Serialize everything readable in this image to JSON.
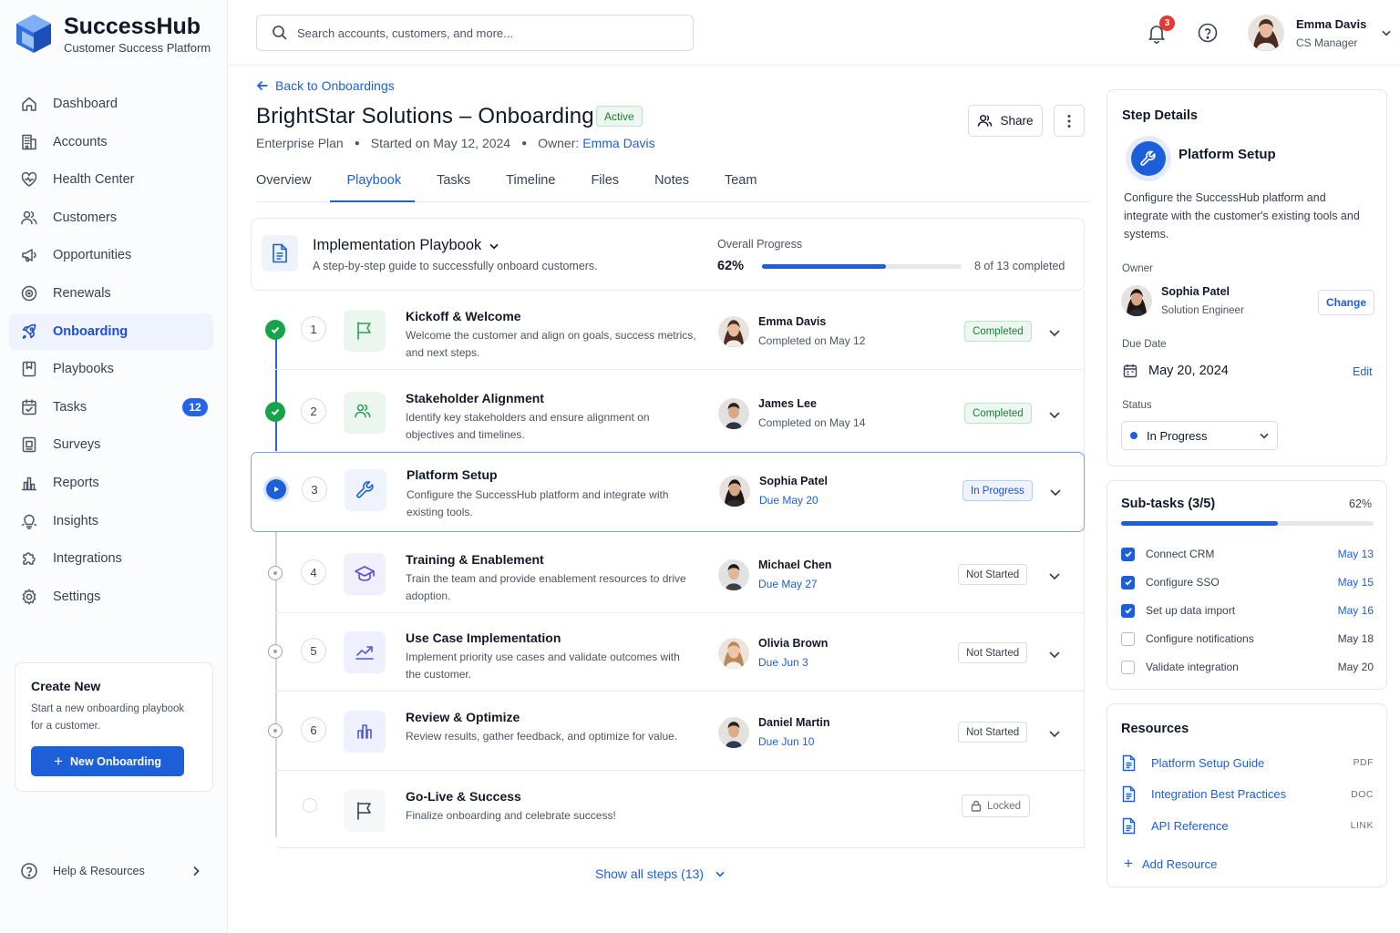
{
  "brand": {
    "name": "SuccessHub",
    "subtitle": "Customer Success Platform"
  },
  "sidebar": {
    "items": [
      {
        "label": "Dashboard",
        "icon": "home-icon"
      },
      {
        "label": "Accounts",
        "icon": "building-icon"
      },
      {
        "label": "Health Center",
        "icon": "heart-icon"
      },
      {
        "label": "Customers",
        "icon": "users-icon"
      },
      {
        "label": "Opportunities",
        "icon": "megaphone-icon"
      },
      {
        "label": "Renewals",
        "icon": "target-icon"
      },
      {
        "label": "Onboarding",
        "icon": "rocket-icon",
        "active": true
      },
      {
        "label": "Playbooks",
        "icon": "bookmark-icon"
      },
      {
        "label": "Tasks",
        "icon": "calendar-check-icon",
        "badge": "12"
      },
      {
        "label": "Surveys",
        "icon": "survey-icon"
      },
      {
        "label": "Reports",
        "icon": "bar-chart-icon"
      },
      {
        "label": "Insights",
        "icon": "lightbulb-icon"
      },
      {
        "label": "Integrations",
        "icon": "puzzle-icon"
      },
      {
        "label": "Settings",
        "icon": "gear-icon"
      }
    ],
    "create_card": {
      "title": "Create New",
      "description": "Start a new onboarding playbook for a customer.",
      "button_label": "New Onboarding"
    },
    "help_label": "Help & Resources"
  },
  "topbar": {
    "search_placeholder": "Search accounts, customers, and more...",
    "notification_count": "3",
    "user": {
      "name": "Emma Davis",
      "role": "CS Manager"
    }
  },
  "header": {
    "back_label": "Back to Onboardings",
    "title": "BrightStar Solutions – Onboarding",
    "status": "Active",
    "plan": "Enterprise Plan",
    "started": "Started on May 12, 2024",
    "owner_prefix": "Owner:",
    "owner_name": "Emma Davis",
    "share_label": "Share"
  },
  "tabs": [
    {
      "label": "Overview"
    },
    {
      "label": "Playbook",
      "active": true
    },
    {
      "label": "Tasks"
    },
    {
      "label": "Timeline"
    },
    {
      "label": "Files"
    },
    {
      "label": "Notes"
    },
    {
      "label": "Team"
    }
  ],
  "playbook": {
    "title": "Implementation Playbook",
    "description": "A step-by-step guide to successfully onboard customers.",
    "progress_label": "Overall Progress",
    "progress_pct": "62%",
    "progress_value": 0.62,
    "completed_text": "8 of 13 completed",
    "show_all_label": "Show all steps (13)",
    "steps": [
      {
        "num": "1",
        "title": "Kickoff & Welcome",
        "desc": "Welcome the customer and align on goals, success metrics, and next steps.",
        "person": "Emma Davis",
        "sub": "Completed on May 12",
        "status": "Completed",
        "state": "completed",
        "icon": "flag-icon"
      },
      {
        "num": "2",
        "title": "Stakeholder Alignment",
        "desc": "Identify key stakeholders and ensure alignment on objectives and timelines.",
        "person": "James Lee",
        "sub": "Completed on May 14",
        "status": "Completed",
        "state": "completed",
        "icon": "users-icon"
      },
      {
        "num": "3",
        "title": "Platform Setup",
        "desc": "Configure the SuccessHub platform and integrate with existing tools.",
        "person": "Sophia Patel",
        "sub": "Due May 20",
        "status": "In Progress",
        "state": "progress",
        "icon": "wrench-icon"
      },
      {
        "num": "4",
        "title": "Training & Enablement",
        "desc": "Train the team and provide enablement resources to drive adoption.",
        "person": "Michael Chen",
        "sub": "Due May 27",
        "status": "Not Started",
        "state": "notstarted",
        "icon": "graduation-cap-icon"
      },
      {
        "num": "5",
        "title": "Use Case Implementation",
        "desc": "Implement priority use cases and validate outcomes with the customer.",
        "person": "Olivia Brown",
        "sub": "Due Jun 3",
        "status": "Not Started",
        "state": "notstarted",
        "icon": "trending-up-icon"
      },
      {
        "num": "6",
        "title": "Review & Optimize",
        "desc": "Review results, gather feedback, and optimize for value.",
        "person": "Daniel Martin",
        "sub": "Due Jun 10",
        "status": "Not Started",
        "state": "notstarted",
        "icon": "bar-chart-icon"
      },
      {
        "num": "",
        "title": "Go-Live & Success",
        "desc": "Finalize onboarding and celebrate success!",
        "person": "",
        "sub": "",
        "status": "Locked",
        "state": "locked",
        "icon": "flag-icon"
      }
    ]
  },
  "step_details": {
    "panel_title": "Step Details",
    "name": "Platform Setup",
    "description": "Configure the SuccessHub platform and integrate with the customer's existing tools and systems.",
    "owner_label": "Owner",
    "owner_name": "Sophia Patel",
    "owner_role": "Solution Engineer",
    "change_label": "Change",
    "due_label": "Due Date",
    "due_value": "May 20, 2024",
    "edit_label": "Edit",
    "status_label": "Status",
    "status_value": "In Progress"
  },
  "subtasks": {
    "title": "Sub-tasks (3/5)",
    "pct": "62%",
    "value": 0.62,
    "items": [
      {
        "label": "Connect CRM",
        "date": "May 13",
        "done": true
      },
      {
        "label": "Configure SSO",
        "date": "May 15",
        "done": true
      },
      {
        "label": "Set up data import",
        "date": "May 16",
        "done": true
      },
      {
        "label": "Configure notifications",
        "date": "May 18",
        "done": false
      },
      {
        "label": "Validate integration",
        "date": "May 20",
        "done": false
      }
    ]
  },
  "resources": {
    "title": "Resources",
    "items": [
      {
        "label": "Platform Setup Guide",
        "type": "PDF"
      },
      {
        "label": "Integration Best Practices",
        "type": "DOC"
      },
      {
        "label": "API Reference",
        "type": "LINK"
      }
    ],
    "add_label": "Add Resource"
  },
  "colors": {
    "accent": "#1d5fd8",
    "success": "#16a34a",
    "border": "#e5e7eb"
  }
}
